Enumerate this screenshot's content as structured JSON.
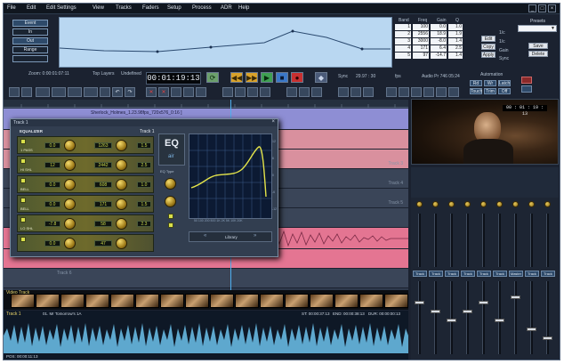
{
  "menu": [
    "File",
    "Edit",
    "Edit Settings",
    "View",
    "Tracks",
    "Faders",
    "Setup",
    "Process",
    "ADR",
    "Help"
  ],
  "window_controls": [
    "_",
    "□",
    "×"
  ],
  "left_panel": {
    "buttons": [
      "Event",
      "In",
      "Out",
      "Range"
    ],
    "info": "Zoom: 0:00:01:07:11"
  },
  "status_bar": {
    "top_layers": "Top Layers",
    "undefined": "Undefined",
    "timecode": "00:01:19:13",
    "sync": "Sync",
    "rate": "29.97 : 30",
    "fps": "fps",
    "audio": "Audio Pr 746 05:24"
  },
  "eq_table": {
    "headers": [
      "Band",
      "Freq",
      "Gain",
      "Q"
    ],
    "rows": [
      [
        "1",
        "100",
        "0.0",
        "1.0"
      ],
      [
        "2",
        "2556",
        "18.9",
        "1.9"
      ],
      [
        "3",
        "3000",
        "-8.0",
        "1.4"
      ],
      [
        "4",
        "171",
        "6.4",
        "2.5"
      ],
      [
        "5",
        "97",
        "-14.7",
        "1.4"
      ]
    ],
    "side_buttons": [
      "Edit",
      "Copy",
      "Apply"
    ],
    "radio_labels": [
      "1/c",
      "1/c",
      "Gain",
      "Sync"
    ]
  },
  "presets": {
    "label": "Presets",
    "save": "Save",
    "delete": "Delete"
  },
  "automation": {
    "label": "Automation",
    "buttons": [
      "Rd",
      "Wr",
      "Latch",
      "Touch",
      "Trim",
      "Off"
    ]
  },
  "clip_title": "Sherlock_Holmes_1.23.98fps_720x576_0:16 ]",
  "tracks": [
    "Track 1",
    "Track 2",
    "Track 3",
    "Track 4",
    "Track 5",
    "Track 6"
  ],
  "video_timecode": "00 : 01 : 19 : 13",
  "video_track_label": "Video Track",
  "audio_track": {
    "label": "Track 1",
    "clip": "01. Mr Tomorrow's 1A",
    "st": "ST: 00:00:37:13",
    "end": "END: 00:00:38:13",
    "dur": "DUR: 00:00:00:13",
    "pos": "POS: 00:00:11:13"
  },
  "eq_panel": {
    "title": "Track 1",
    "header_left": "EQUALIZER",
    "header_center": "Track 1",
    "logo": "EQ",
    "logo_sub": "air",
    "eq_type": "EQ Type",
    "library": "Library",
    "bands": [
      {
        "label": "1 PASS",
        "gain": "0.0",
        "freq": "1263",
        "q": "1.5"
      },
      {
        "label": "HI SHL",
        "gain": "12",
        "freq": "2442",
        "q": "2.5"
      },
      {
        "label": "BELL",
        "gain": "0.0",
        "freq": "608",
        "q": "1.0"
      },
      {
        "label": "BELL",
        "gain": "0.0",
        "freq": "171",
        "q": "1.5"
      },
      {
        "label": "LO SHL",
        "gain": "-7.8",
        "freq": "58",
        "q": "2.3"
      },
      {
        "label": "",
        "gain": "0.0",
        "freq": "47",
        "q": ""
      }
    ],
    "freq_labels": [
      "50",
      "100",
      "200",
      "500",
      "1K",
      "2K",
      "5K",
      "10K",
      "20K"
    ],
    "gain_labels": [
      "12",
      "6",
      "0",
      "-6",
      "-12"
    ]
  },
  "mixer": {
    "send_label": "Sends",
    "track_labels": [
      "Track",
      "Track",
      "Track",
      "Track",
      "Track",
      "Track",
      "Master",
      "Track",
      "Track"
    ],
    "mute": "M",
    "solo": "S"
  },
  "colors": {
    "menu_bg": "#10161f",
    "curve_bg": "#b9d7f1",
    "track_blue": "#8e8ed4",
    "track_pink": "#d9909e",
    "track_hotpink": "#e47592",
    "wave": "#6cc2ec",
    "eq_yellow": "#d9c64a"
  }
}
